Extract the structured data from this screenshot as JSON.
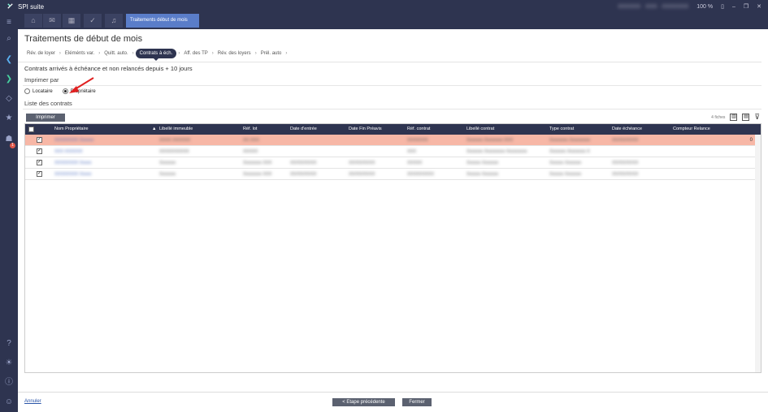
{
  "app": {
    "title": "SPI suite",
    "active_tab": "Traitements début de mois",
    "zoom": "100 %"
  },
  "page": {
    "title": "Traitements de début de mois",
    "steps": [
      "Rév. de loyer",
      "Eléménts var.",
      "Quitt. auto.",
      "Contrats à éch.",
      "Aff. des TP",
      "Rév. des loyers",
      "Prél. auto"
    ],
    "active_step": "Contrats à éch.",
    "info": "Contrats arrivés à échéance et non relancés depuis + 10 jours",
    "print_section": "Imprimer par",
    "radio_locataire": "Locataire",
    "radio_proprietaire": "Propriétaire",
    "list_section": "Liste des contrats",
    "print_button": "Imprimer",
    "count_label": "4 fiches"
  },
  "grid": {
    "columns": [
      "Nom Propriétaire",
      "Libellé immeuble",
      "Réf. lot",
      "Date d'entrée",
      "Date Fin Préavis",
      "Réf. contrat",
      "Libellé contrat",
      "Type contrat",
      "Date échéance",
      "Compteur Relance"
    ],
    "rows": [
      {
        "c": [
          "XXXXXXXX Xxxxxx",
          "XXXX XXXXXX",
          "XX XXX",
          "",
          "",
          "XXXXXXX",
          "Xxxxxxx Xxxxxxxx XXX",
          "Xxxxxxxx Xxxxxxxxx",
          "XX/XX/XXXX",
          ""
        ],
        "counter": "0"
      },
      {
        "c": [
          "XXX XXXXXX",
          "XXXXXXXXXX",
          "XXXXX",
          "",
          "",
          "XXX",
          "Xxxxxxx Xxxxxxxxx Xxxxxxxxx",
          "Xxxxxxx Xxxxxxxx X",
          "",
          ""
        ],
        "counter": ""
      },
      {
        "c": [
          "XXXXXXXX Xxxxx",
          "Xxxxxxx",
          "Xxxxxxxx XXX",
          "XX/XX/XXXX",
          "XX/XX/XXXX",
          "XXXXX",
          "Xxxxxx Xxxxxxx",
          "Xxxxxx Xxxxxxx",
          "XX/XX/XXXX",
          ""
        ],
        "counter": ""
      },
      {
        "c": [
          "XXXXXXXX Xxxxx",
          "Xxxxxxx",
          "Xxxxxxxx XXX",
          "XX/XX/XXXX",
          "XX/XX/XXXX",
          "XXXXXXXXX",
          "Xxxxxx Xxxxxxx",
          "Xxxxxx Xxxxxxx",
          "XX/XX/XXXX",
          ""
        ],
        "counter": ""
      }
    ]
  },
  "footer": {
    "cancel": "Annuler",
    "previous": "< Etape précédente",
    "close": "Fermer"
  }
}
